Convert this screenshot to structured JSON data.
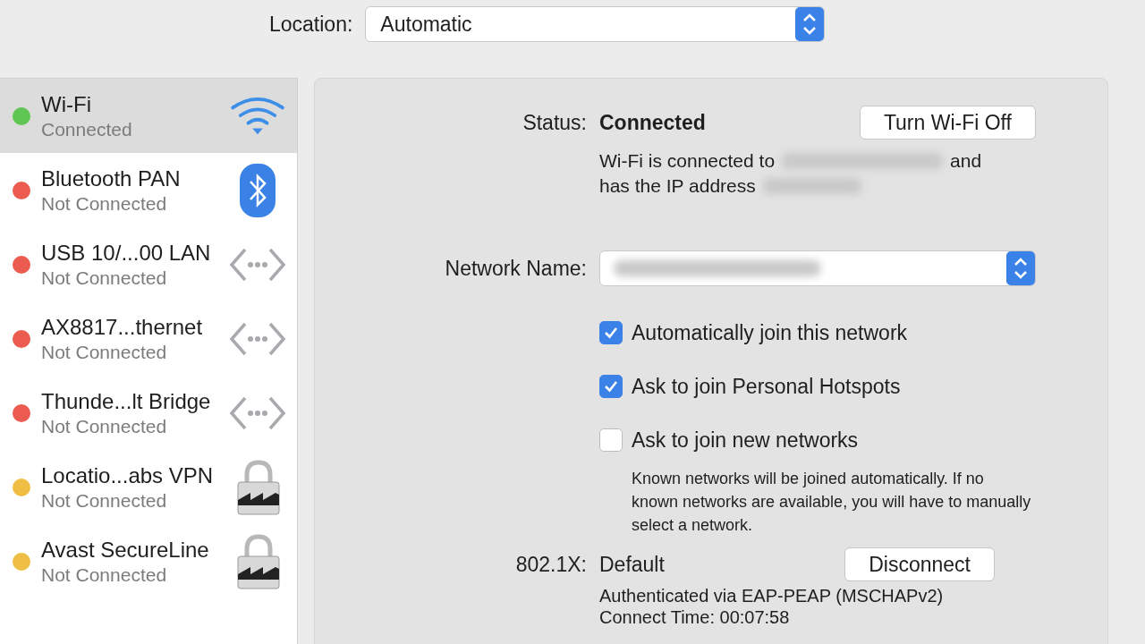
{
  "location": {
    "label": "Location:",
    "value": "Automatic"
  },
  "services": [
    {
      "name": "Wi-Fi",
      "status": "Connected",
      "color": "#5fc553",
      "kind": "wifi",
      "selected": true
    },
    {
      "name": "Bluetooth PAN",
      "status": "Not Connected",
      "color": "#ec5b4f",
      "kind": "bluetooth",
      "selected": false
    },
    {
      "name": "USB 10/...00 LAN",
      "status": "Not Connected",
      "color": "#ec5b4f",
      "kind": "ethernet",
      "selected": false
    },
    {
      "name": "AX8817...thernet",
      "status": "Not Connected",
      "color": "#ec5b4f",
      "kind": "ethernet",
      "selected": false
    },
    {
      "name": "Thunde...lt Bridge",
      "status": "Not Connected",
      "color": "#ec5b4f",
      "kind": "ethernet",
      "selected": false
    },
    {
      "name": "Locatio...abs VPN",
      "status": "Not Connected",
      "color": "#f0be45",
      "kind": "vpn",
      "selected": false
    },
    {
      "name": "Avast SecureLine",
      "status": "Not Connected",
      "color": "#f0be45",
      "kind": "vpn",
      "selected": false
    }
  ],
  "detail": {
    "status_label": "Status:",
    "status_value": "Connected",
    "toggle_button": "Turn Wi-Fi Off",
    "connected_to": "Wi-Fi is connected to",
    "connected_and": "and",
    "ip_text": "has the IP address",
    "network_name_label": "Network Name:",
    "options": [
      {
        "label": "Automatically join this network",
        "checked": true
      },
      {
        "label": "Ask to join Personal Hotspots",
        "checked": true
      },
      {
        "label": "Ask to join new networks",
        "checked": false
      }
    ],
    "hint": "Known networks will be joined automatically. If no known networks are available, you will have to manually select a network.",
    "eap_label": "802.1X:",
    "eap_value": "Default",
    "eap_button": "Disconnect",
    "auth_lines": [
      "Authenticated via EAP-PEAP (MSCHAPv2)",
      "Connect Time: 00:07:58"
    ]
  }
}
